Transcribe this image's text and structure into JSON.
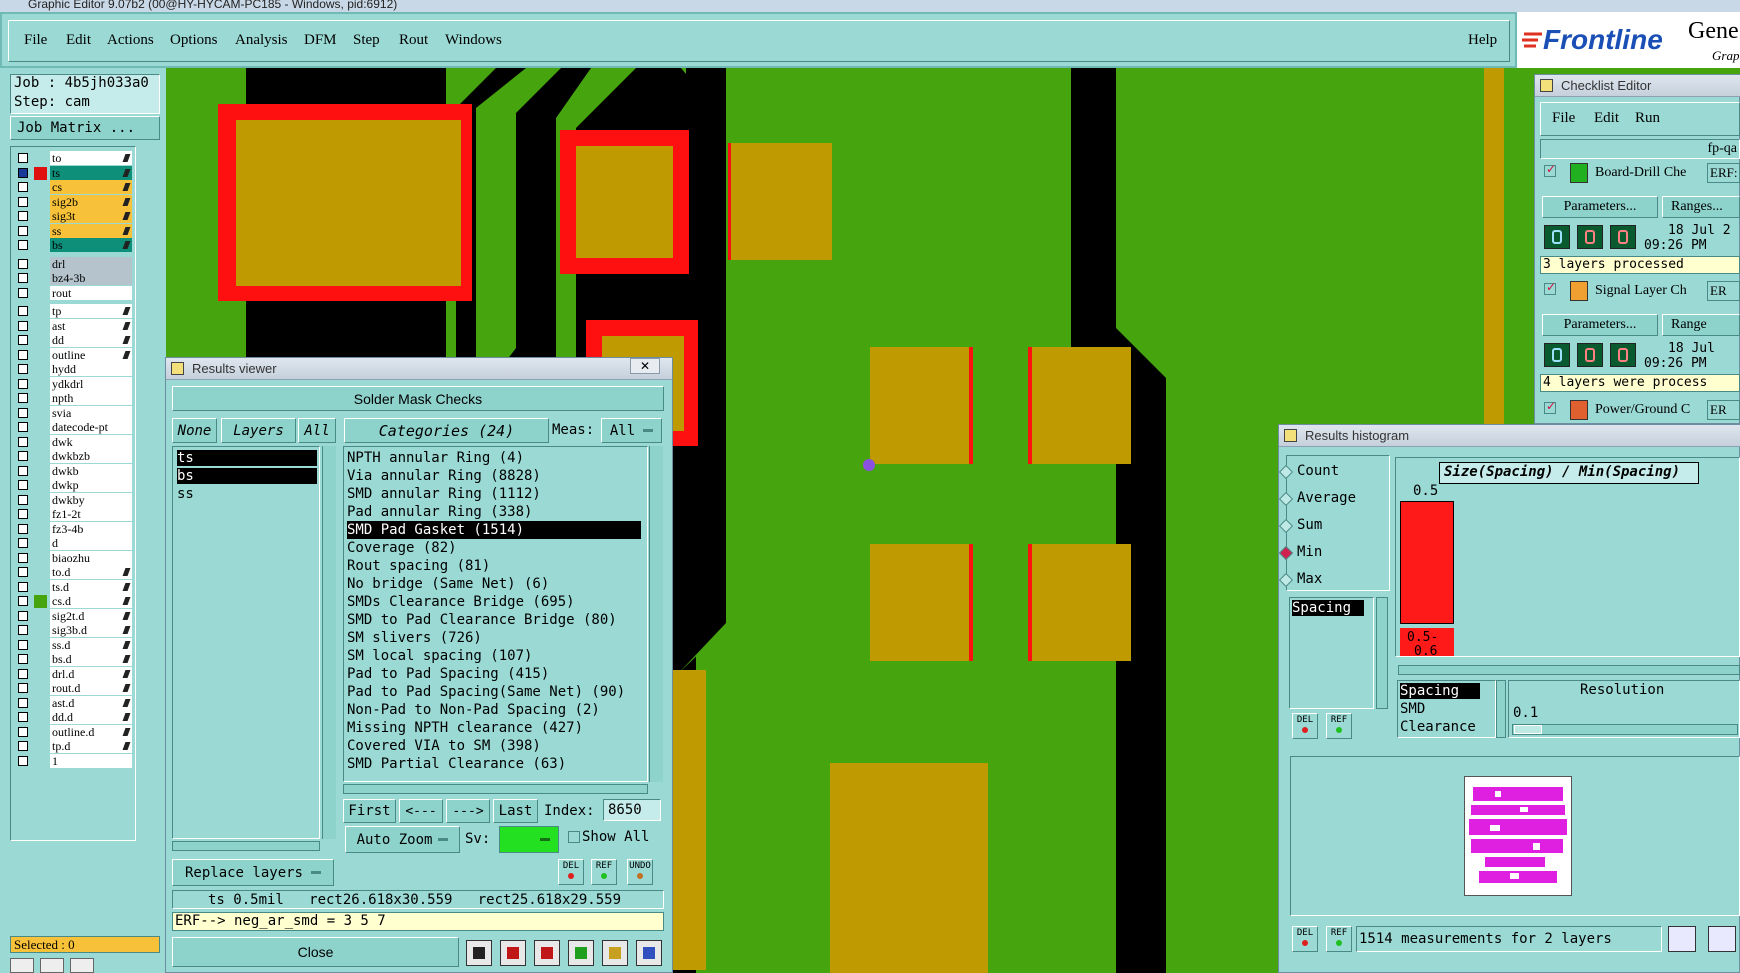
{
  "window": {
    "title": "Graphic Editor 9.07b2 (00@HY-HYCAM-PC185 - Windows, pid:6912)"
  },
  "menu": {
    "items": [
      "File",
      "Edit",
      "Actions",
      "Options",
      "Analysis",
      "DFM",
      "Step",
      "Rout",
      "Windows"
    ],
    "help": "Help"
  },
  "brand": {
    "logo": "Frontline",
    "trail1": "Gene",
    "trail2": "Grap"
  },
  "job": {
    "job_label": "Job : 4b5jh033a0",
    "step_label": "Step: cam",
    "matrix_button": "Job Matrix ..."
  },
  "layers": {
    "group1": [
      {
        "name": "to",
        "color": "#ffffff"
      },
      {
        "name": "ts",
        "color": "#0e8f7a"
      },
      {
        "name": "cs",
        "color": "#f7c23a"
      },
      {
        "name": "sig2b",
        "color": "#f7c23a"
      },
      {
        "name": "sig3t",
        "color": "#f7c23a"
      },
      {
        "name": "ss",
        "color": "#f7c23a"
      },
      {
        "name": "bs",
        "color": "#0e8f7a"
      }
    ],
    "group2": [
      {
        "name": "drl",
        "color": "#b4c3cc"
      },
      {
        "name": "bz4-3b",
        "color": "#b4c3cc"
      },
      {
        "name": "rout",
        "color": "#ffffff"
      }
    ],
    "group3": [
      "tp",
      "ast",
      "dd",
      "outline",
      "hydd",
      "ydkdrl",
      "npth",
      "svia",
      "datecode-pt",
      "dwk",
      "dwkbzb",
      "dwkb",
      "dwkp",
      "dwkby",
      "fz1-2t",
      "fz3-4b",
      "d",
      "biaozhu",
      "to.d",
      "ts.d",
      "cs.d",
      "sig2t.d",
      "sig3b.d",
      "ss.d",
      "bs.d",
      "drl.d",
      "rout.d",
      "ast.d",
      "dd.d",
      "outline.d",
      "tp.d",
      "1"
    ],
    "selected": "Selected : 0"
  },
  "results_viewer": {
    "title": "Results viewer",
    "header": "Solder Mask Checks",
    "none_btn": "None",
    "layers_btn": "Layers",
    "all_btn": "All",
    "categories_btn": "Categories (24)",
    "meas_label": "Meas:",
    "meas_value": "All",
    "layer_list": [
      "ts",
      "bs",
      "ss"
    ],
    "categories": [
      "NPTH annular Ring (4)",
      "Via annular Ring (8828)",
      "SMD annular Ring (1112)",
      "Pad annular Ring (338)",
      "SMD Pad Gasket (1514)",
      "Coverage (82)",
      "Rout spacing (81)",
      "No bridge (Same Net) (6)",
      "SMDs Clearance Bridge (695)",
      "SMD to Pad Clearance Bridge (80)",
      "SM slivers (726)",
      "SM local spacing (107)",
      "Pad to Pad Spacing (415)",
      "Pad to Pad Spacing(Same Net) (90)",
      "Non-Pad to Non-Pad Spacing (2)",
      "Missing NPTH clearance (427)",
      "Covered VIA to SM (398)",
      "SMD Partial Clearance (63)"
    ],
    "selected_category": "SMD Pad Gasket (1514)",
    "nav_first": "First",
    "nav_prev": "<---",
    "nav_next": "--->",
    "nav_last": "Last",
    "index_label": "Index:",
    "index_value": "8650",
    "auto_zoom": "Auto Zoom",
    "sv_label": "Sv:",
    "show_all": "Show All",
    "replace_layers": "Replace layers",
    "del": "DEL",
    "ref": "REF",
    "undo": "UNDO",
    "status_line": "ts 0.5mil   rect26.618x30.559   rect25.618x29.559",
    "erf_line": "ERF--> neg_ar_smd = 3 5 7",
    "close": "Close",
    "status_colors": {
      "sv": "#23e021"
    }
  },
  "checklist": {
    "title": "Checklist Editor",
    "menu": [
      "File",
      "Edit",
      "Run"
    ],
    "name": "fp-qa",
    "items": [
      {
        "name": "Board-Drill Che",
        "erf": "ERF:",
        "params": "Parameters...",
        "ranges": "Ranges...",
        "date": "18 Jul 2",
        "time": "09:26 PM",
        "status": "3 layers processed"
      },
      {
        "name": "Signal Layer Ch",
        "erf": "ER",
        "params": "Parameters...",
        "ranges": "Range",
        "date": "18 Jul",
        "time": "09:26 PM",
        "status": "4 layers were process"
      },
      {
        "name": "Power/Ground C",
        "erf": "ER"
      }
    ]
  },
  "histogram": {
    "title": "Results histogram",
    "modes": [
      "Count",
      "Average",
      "Sum",
      "Min",
      "Max"
    ],
    "selected_mode": "Min",
    "chart_title": "Size(Spacing) / Min(Spacing)",
    "bar_value": "0.5",
    "bar_label_1": "0.5-",
    "bar_label_2": "0.6",
    "list1": [
      "Spacing"
    ],
    "list2": [
      "Spacing",
      "SMD",
      "Clearance"
    ],
    "resolution_label": "Resolution",
    "resolution_value": "0.1",
    "del": "DEL",
    "ref": "REF",
    "summary": "1514 measurements for 2 layers",
    "bar_color": "#ff1a1a"
  },
  "colors": {
    "board_green": "#46a50f",
    "pad_gold": "#bf9a00",
    "mask_red": "#ff1010",
    "trace_black": "#000000",
    "ui_teal": "#9ad9d4"
  }
}
